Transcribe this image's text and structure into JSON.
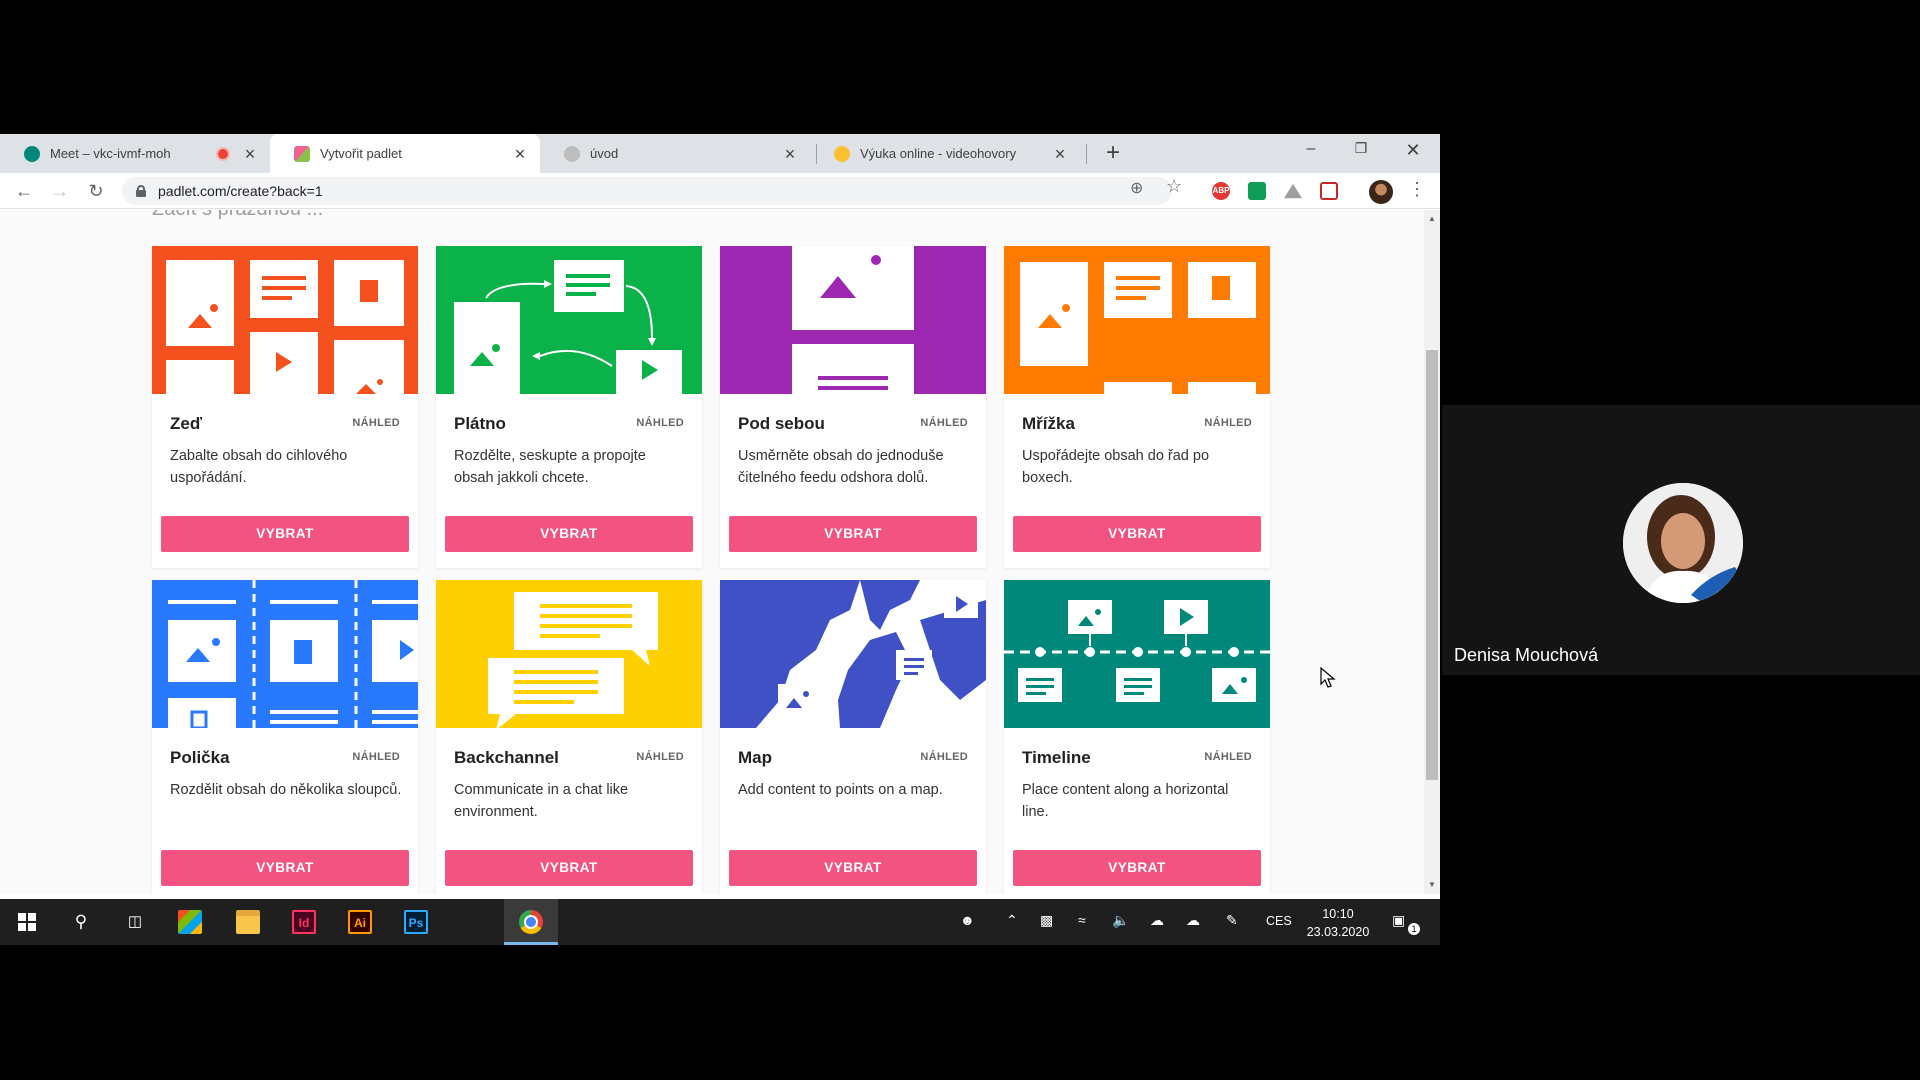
{
  "browser": {
    "tabs": [
      {
        "label": "Meet – vkc-ivmf-moh",
        "fav_color": "#00897b",
        "recording": true
      },
      {
        "label": "Vytvořit padlet",
        "fav_color": "#ab47bc"
      },
      {
        "label": "úvod",
        "fav_color": "#757575"
      },
      {
        "label": "Výuka online - videohovory",
        "fav_color": "#fbc02d"
      }
    ],
    "close_glyph": "×",
    "new_tab_glyph": "+",
    "url": "padlet.com/create?back=1",
    "extensions": [
      {
        "name": "adblock-plus",
        "label": "ABP",
        "color": "#e53935"
      },
      {
        "name": "sheets-ext",
        "label": "",
        "color": "#0f9d58"
      },
      {
        "name": "drive-ext",
        "label": "",
        "color": "#9e9e9e"
      },
      {
        "name": "pdf-ext",
        "label": "",
        "color": "#c62828"
      }
    ]
  },
  "page": {
    "subheading": "Začít s prázdnou ...",
    "cards": [
      {
        "title": "Zeď",
        "preview": "NÁHLED",
        "desc": "Zabalte obsah do cihlového uspořádání.",
        "button": "VYBRAT",
        "color": "#f4511e"
      },
      {
        "title": "Plátno",
        "preview": "NÁHLED",
        "desc": "Rozdělte, seskupte a propojte obsah jakkoli chcete.",
        "button": "VYBRAT",
        "color": "#0bb24a"
      },
      {
        "title": "Pod sebou",
        "preview": "NÁHLED",
        "desc": "Usměrněte obsah do jednoduše čitelného feedu odshora dolů.",
        "button": "VYBRAT",
        "color": "#9c27b0"
      },
      {
        "title": "Mřížka",
        "preview": "NÁHLED",
        "desc": "Uspořádejte obsah do řad po boxech.",
        "button": "VYBRAT",
        "color": "#ff7c00"
      },
      {
        "title": "Polička",
        "preview": "NÁHLED",
        "desc": "Rozdělit obsah do několika sloupců.",
        "button": "VYBRAT",
        "color": "#2979ff"
      },
      {
        "title": "Backchannel",
        "preview": "NÁHLED",
        "desc": "Communicate in a chat like environment.",
        "button": "VYBRAT",
        "color": "#ffd000"
      },
      {
        "title": "Map",
        "preview": "NÁHLED",
        "desc": "Add content to points on a map.",
        "button": "VYBRAT",
        "color": "#3f51c5"
      },
      {
        "title": "Timeline",
        "preview": "NÁHLED",
        "desc": "Place content along a horizontal line.",
        "button": "VYBRAT",
        "color": "#00897b"
      }
    ]
  },
  "taskbar": {
    "apps": [
      {
        "name": "indesign",
        "label": "Id",
        "color": "#ff3366",
        "bg": "#49021f"
      },
      {
        "name": "illustrator",
        "label": "Ai",
        "color": "#ff9a00",
        "bg": "#330000"
      },
      {
        "name": "photoshop",
        "label": "Ps",
        "color": "#31a8ff",
        "bg": "#001e36"
      }
    ],
    "language": "CES",
    "time": "10:10",
    "date": "23.03.2020",
    "notifications": "1"
  },
  "meet": {
    "participant_name": "Denisa Mouchová"
  }
}
